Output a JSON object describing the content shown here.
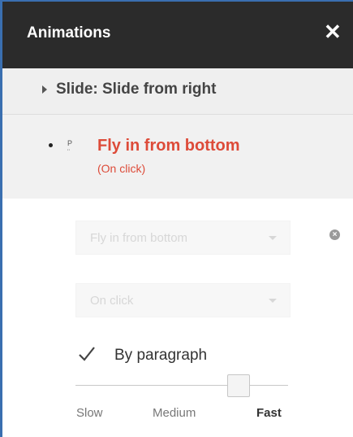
{
  "panel": {
    "title": "Animations",
    "close_symbol": "✕"
  },
  "slide_transition": {
    "label": "Slide: Slide from right"
  },
  "animation_item": {
    "title": "Fly in from bottom",
    "trigger": "(On click)"
  },
  "effect_dropdown": {
    "selected": "Fly in from bottom"
  },
  "start_dropdown": {
    "selected": "On click"
  },
  "by_paragraph": {
    "label": "By paragraph",
    "checked": true
  },
  "speed": {
    "labels": [
      "Slow",
      "Medium",
      "Fast"
    ],
    "selected": "Fast",
    "level": 0.73
  },
  "colors": {
    "header_bg": "#2b2b2b",
    "accent_red": "#dd4b39",
    "frame_blue": "#3a6fb0"
  },
  "icons": {
    "close": "close-icon",
    "expand": "triangle-right-icon",
    "remove": "remove-icon",
    "check": "checkmark-icon",
    "dropdown": "chevron-down-icon"
  }
}
